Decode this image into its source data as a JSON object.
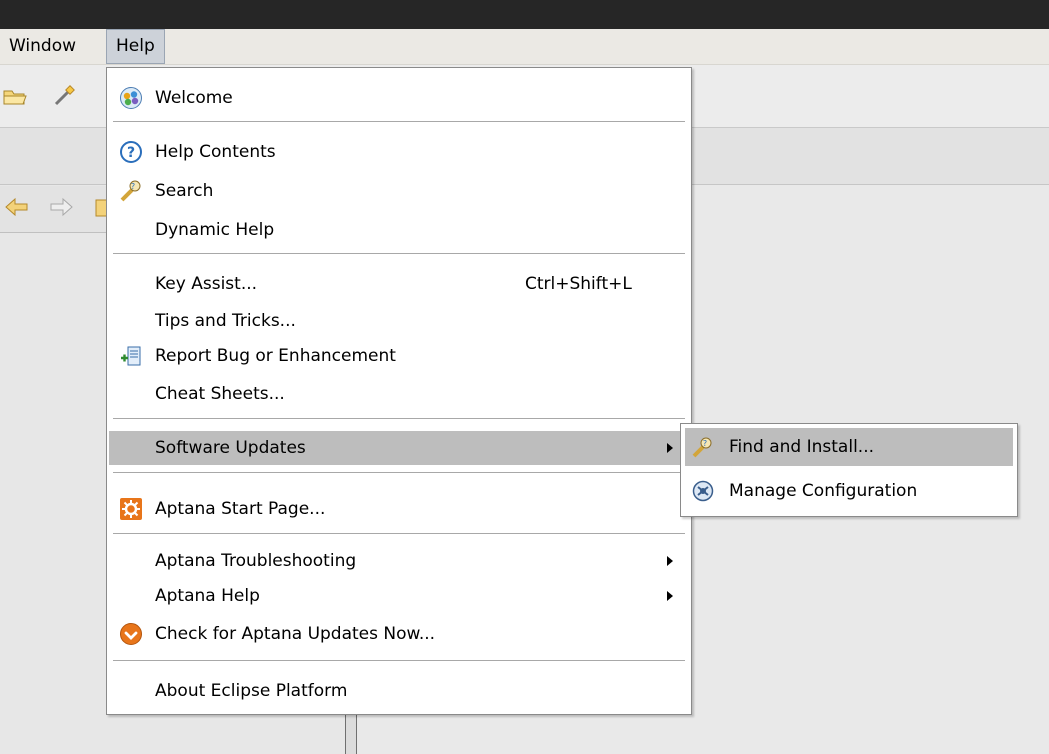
{
  "menubar": {
    "items": [
      {
        "label": "Window"
      },
      {
        "label": "Help"
      }
    ]
  },
  "help_menu": {
    "items": [
      {
        "label": "Welcome",
        "icon": "welcome-icon"
      },
      {
        "label": "Help Contents",
        "icon": "help-contents-icon"
      },
      {
        "label": "Search",
        "icon": "search-icon"
      },
      {
        "label": "Dynamic Help",
        "icon": ""
      },
      {
        "label": "Key Assist...",
        "icon": "",
        "shortcut": "Ctrl+Shift+L"
      },
      {
        "label": "Tips and Tricks...",
        "icon": ""
      },
      {
        "label": "Report Bug or Enhancement",
        "icon": "report-bug-icon"
      },
      {
        "label": "Cheat Sheets...",
        "icon": ""
      },
      {
        "label": "Software Updates",
        "icon": "",
        "submenu": true,
        "highlighted": true
      },
      {
        "label": "Aptana Start Page...",
        "icon": "aptana-start-icon"
      },
      {
        "label": "Aptana Troubleshooting",
        "icon": "",
        "submenu": true
      },
      {
        "label": "Aptana Help",
        "icon": "",
        "submenu": true
      },
      {
        "label": "Check for Aptana Updates Now...",
        "icon": "aptana-update-icon"
      },
      {
        "label": "About Eclipse Platform",
        "icon": ""
      }
    ]
  },
  "software_updates_submenu": {
    "items": [
      {
        "label": "Find and Install...",
        "icon": "find-install-icon",
        "highlighted": true
      },
      {
        "label": "Manage Configuration",
        "icon": "manage-configuration-icon"
      }
    ]
  },
  "colors": {
    "titlebar": "#262626",
    "menubar": "#ebe9e4",
    "menu_highlight": "#bdbdbd",
    "aptana_orange": "#e8751a"
  }
}
